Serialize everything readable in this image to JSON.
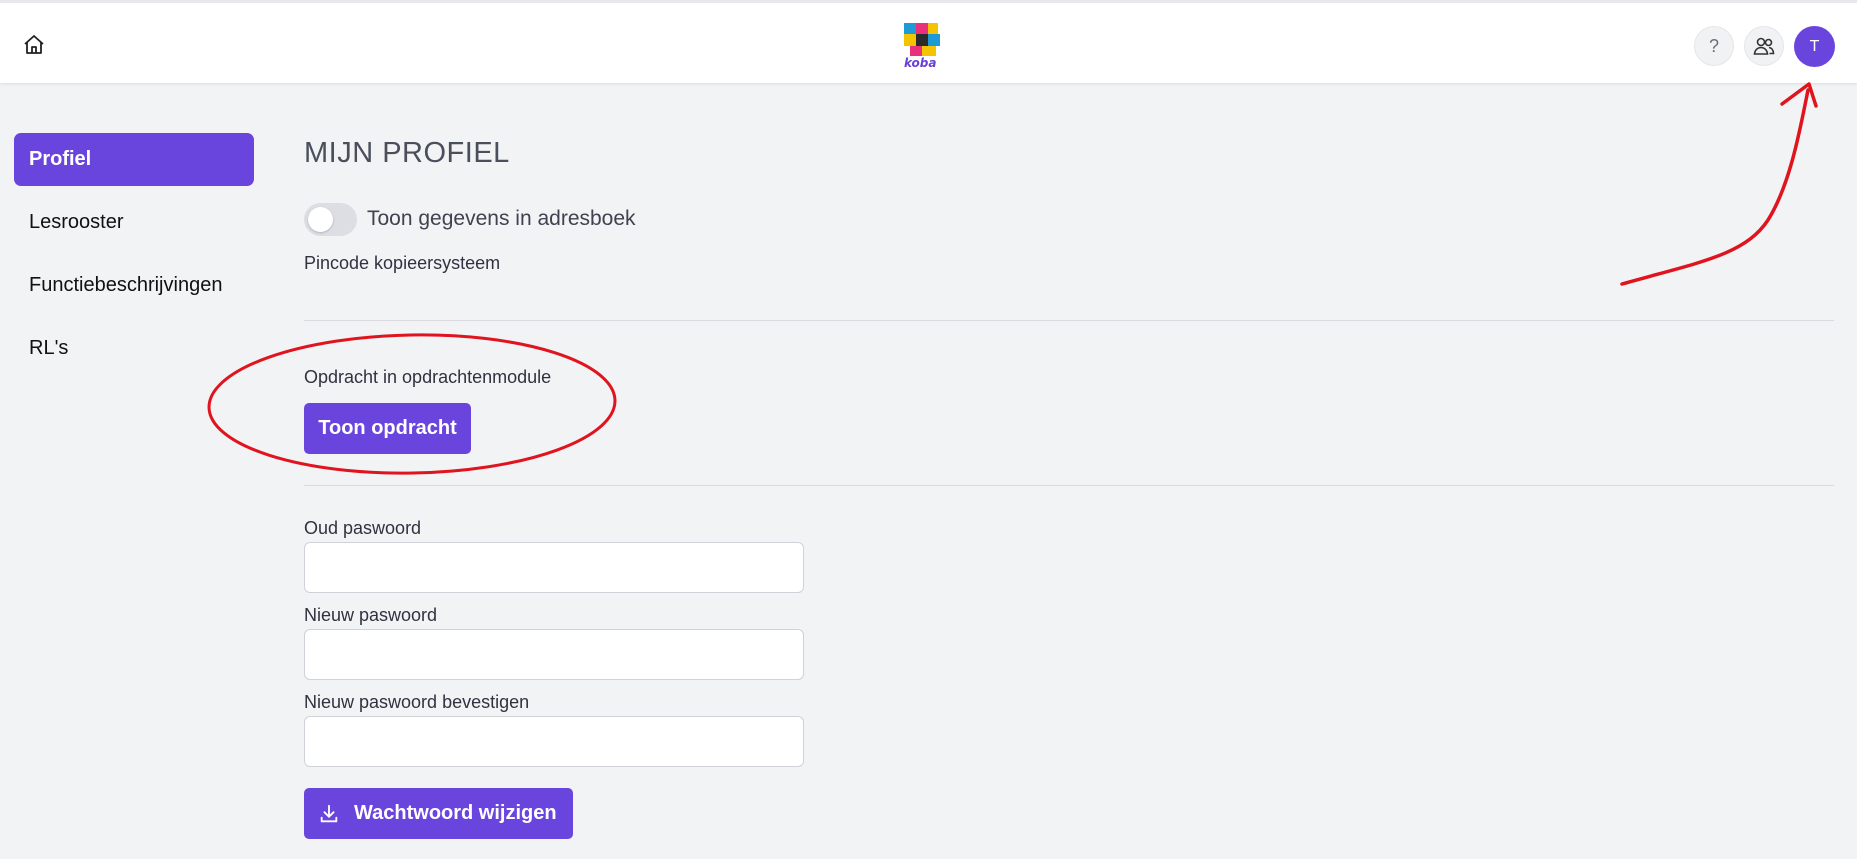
{
  "header": {
    "logo_text": "koba",
    "help_symbol": "?",
    "avatar_initial": "T",
    "icons": [
      "home-icon",
      "help-icon",
      "people-icon"
    ]
  },
  "sidebar": {
    "items": [
      {
        "label": "Profiel",
        "active": true
      },
      {
        "label": "Lesrooster",
        "active": false
      },
      {
        "label": "Functiebeschrijvingen",
        "active": false
      },
      {
        "label": "RL's",
        "active": false
      }
    ]
  },
  "main": {
    "title": "MIJN PROFIEL",
    "toggle_label": "Toon gegevens in adresboek",
    "toggle_on": false,
    "pincode_label": "Pincode kopieersysteem",
    "opdracht_label": "Opdracht in opdrachtenmodule",
    "show_button": "Toon opdracht",
    "old_password_label": "Oud paswoord",
    "new_password_label": "Nieuw paswoord",
    "confirm_password_label": "Nieuw paswoord bevestigen",
    "save_button": "Wachtwoord wijzigen"
  },
  "colors": {
    "accent": "#6a45dd",
    "annotation": "#e0141e",
    "background": "#f2f3f5"
  }
}
